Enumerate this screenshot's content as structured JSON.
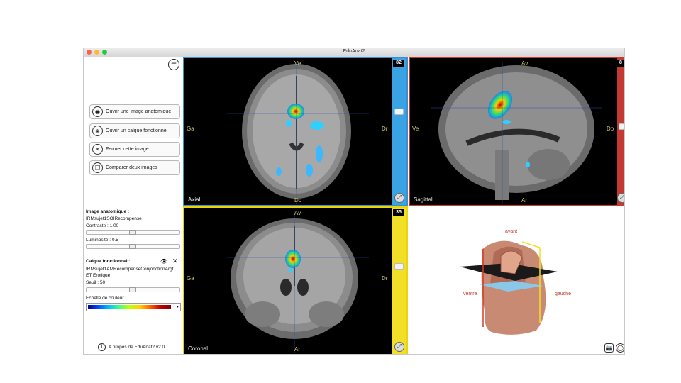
{
  "window": {
    "title": "EduAnat2"
  },
  "sidebar": {
    "buttons": [
      {
        "label": "Ouvrir une image anatomique",
        "icon": "eye-open-icon"
      },
      {
        "label": "Ouvrir un calque fonctionnel",
        "icon": "layer-eye-icon"
      },
      {
        "label": "Fermer cette image",
        "icon": "close-circle-icon"
      },
      {
        "label": "Comparer deux images",
        "icon": "compare-icon"
      }
    ],
    "anatomical": {
      "heading": "Image anatomique :",
      "filename": "IRMsujet1SOIRecompense",
      "contrast_label": "Contraste : 1.00",
      "contrast": 0.5,
      "brightness_label": "Luminosité : 0.5",
      "brightness": 0.5
    },
    "functional": {
      "heading": "Calque fonctionnel :",
      "filename": "IRMsujet1AMRecompenseConjonctionArgt",
      "filename2": "ET Erotique",
      "threshold_label": "Seuil : 50",
      "threshold": 0.5,
      "colorscale_label": "Echelle de couleur :"
    },
    "about": "A propos de EduAnat2 v2.0"
  },
  "views": {
    "axial": {
      "name": "Axial",
      "slice": "82",
      "top": "Ve",
      "bottom": "Do",
      "left": "Ga",
      "right": "Dr",
      "slider_pos": 0.4
    },
    "sagittal": {
      "name": "Sagittal",
      "slice": "8",
      "top": "Av",
      "bottom": "Ar",
      "left": "Ve",
      "right": "Do",
      "slider_pos": 0.5
    },
    "coronal": {
      "name": "Coronal",
      "slice": "35",
      "top": "Av",
      "bottom": "Ar",
      "left": "Ga",
      "right": "Dr",
      "slider_pos": 0.45
    },
    "three_d": {
      "labels": {
        "front": "avant",
        "left": "ventre",
        "right": "gauche"
      }
    }
  },
  "colors": {
    "axial": "#3a8fd0",
    "sagittal": "#c43a31",
    "coronal": "#e8d60a"
  }
}
